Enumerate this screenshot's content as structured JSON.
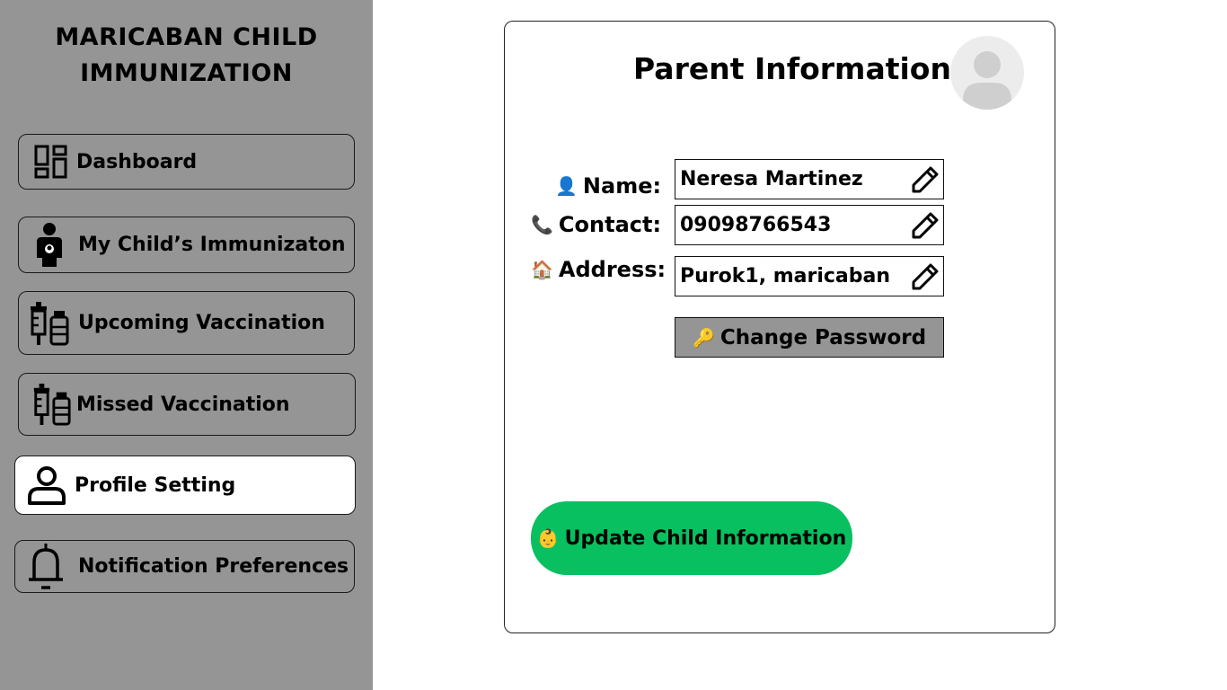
{
  "app": {
    "title_line1": "MARICABAN CHILD",
    "title_line2": "IMMUNIZATION"
  },
  "sidebar": {
    "items": [
      {
        "label": "Dashboard",
        "icon": "dashboard-grid-icon"
      },
      {
        "label": "My Child’s Immunizaton",
        "icon": "child-person-icon"
      },
      {
        "label": "Upcoming Vaccination",
        "icon": "syringe-vial-icon"
      },
      {
        "label": "Missed  Vaccination",
        "icon": "syringe-vial-icon"
      },
      {
        "label": "Profile Setting",
        "icon": "user-profile-icon",
        "active": true
      },
      {
        "label": "Notification Preferences",
        "icon": "bell-icon"
      }
    ]
  },
  "main": {
    "title": "Parent Information",
    "fields": {
      "name": {
        "label": "Name:",
        "value": "Neresa Martinez",
        "icon": "person-emoji"
      },
      "contact": {
        "label": "Contact:",
        "value": "09098766543",
        "icon": "phone-emoji"
      },
      "address": {
        "label": "Address:",
        "value": "Purok1, maricaban",
        "icon": "house-emoji"
      }
    },
    "change_password_label": "Change Password",
    "update_child_label": "Update Child Information"
  },
  "colors": {
    "sidebar_bg": "#959595",
    "active_item_bg": "#ffffff",
    "update_button": "#08c060",
    "change_password_button": "#959595"
  }
}
